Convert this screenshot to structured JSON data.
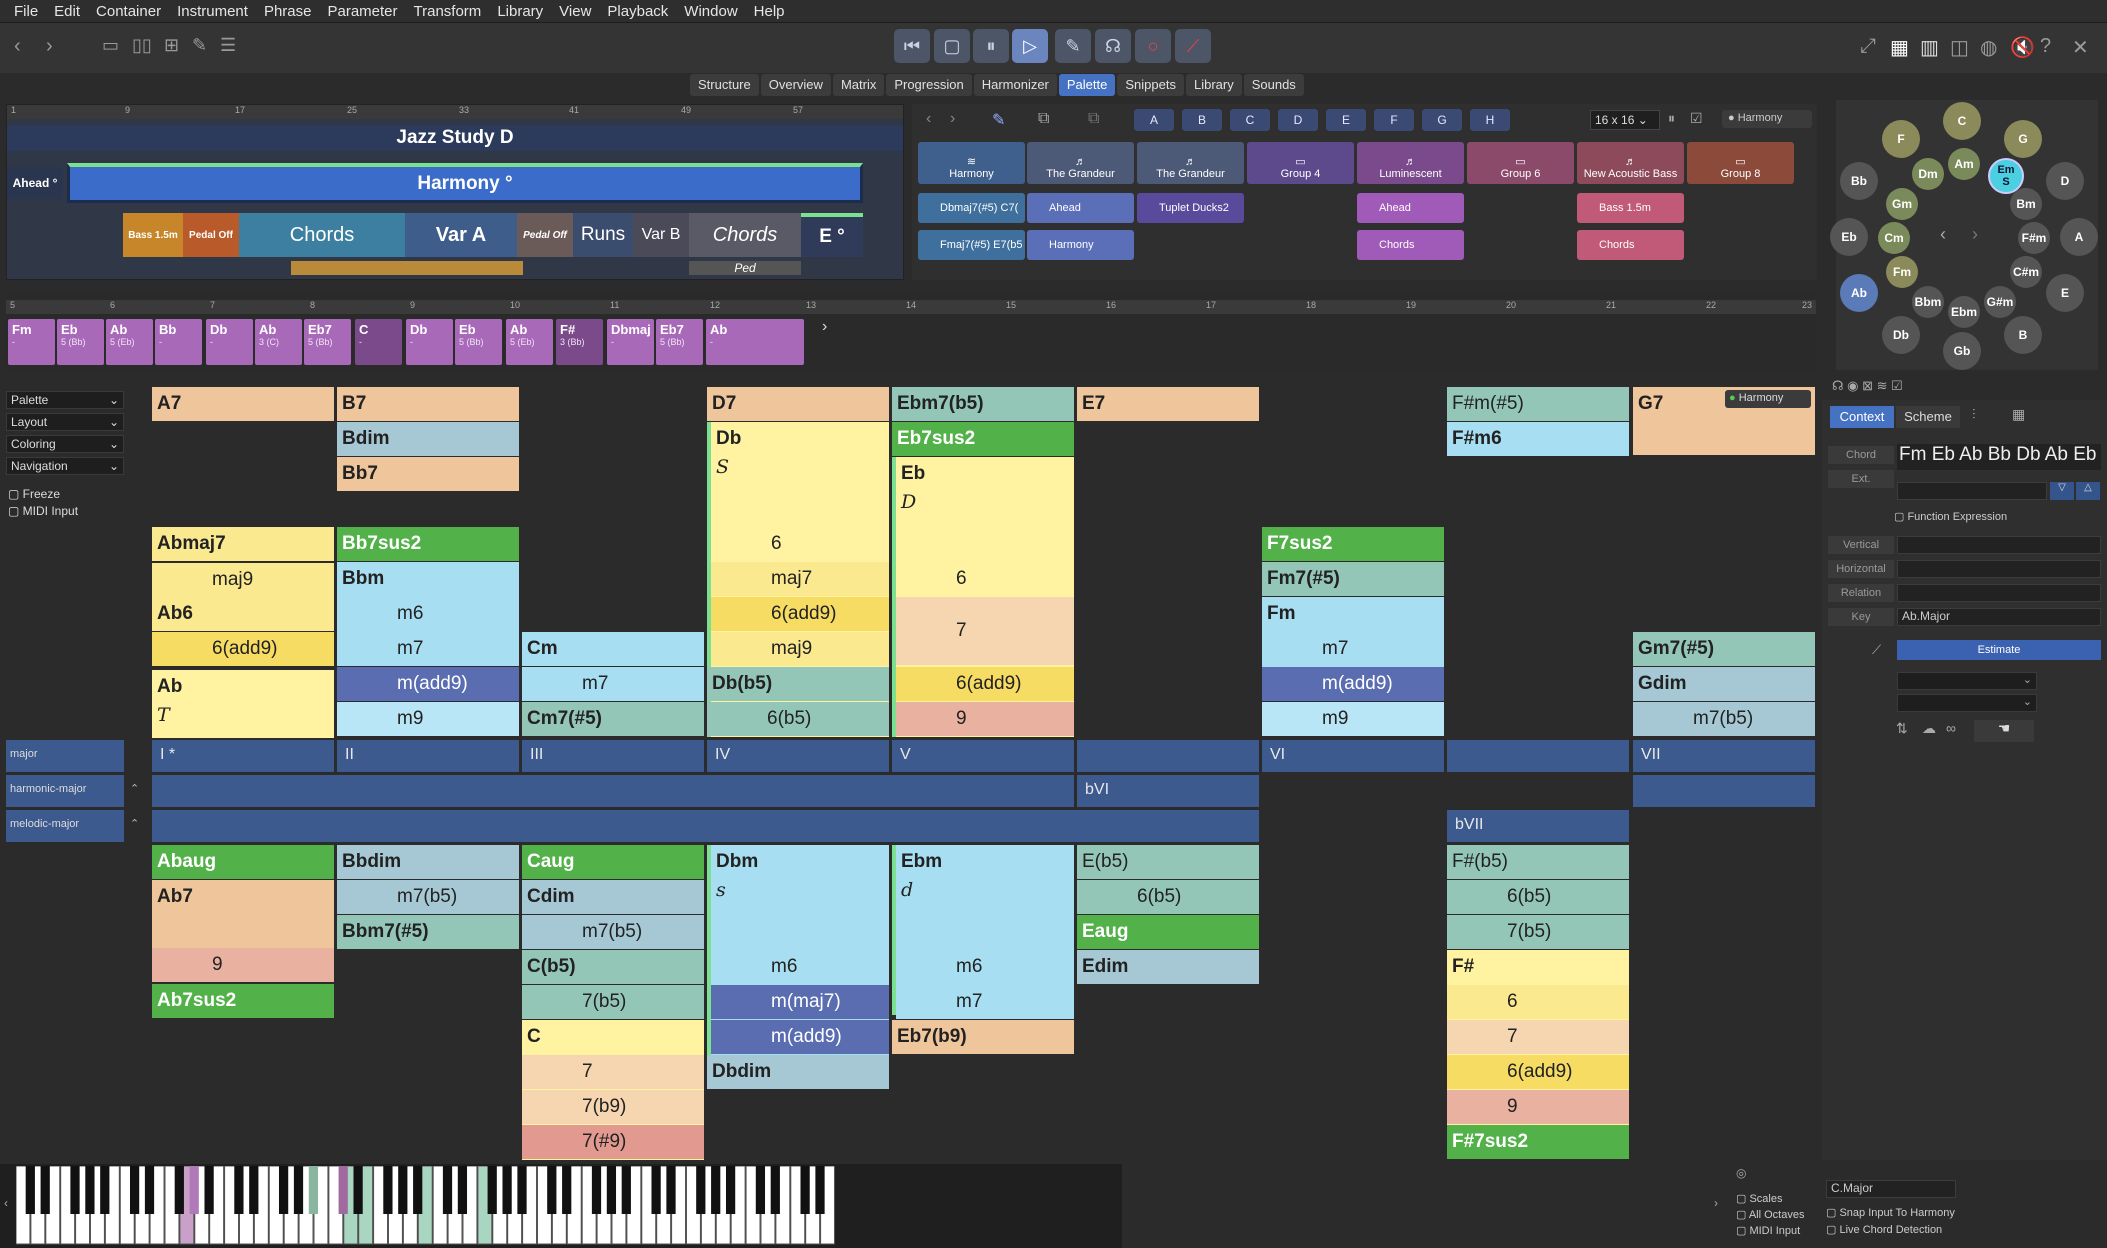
{
  "menu": [
    "File",
    "Edit",
    "Container",
    "Instrument",
    "Phrase",
    "Parameter",
    "Transform",
    "Library",
    "View",
    "Playback",
    "Window",
    "Help"
  ],
  "tabs": [
    "Structure",
    "Overview",
    "Matrix",
    "Progression",
    "Harmonizer",
    "Palette",
    "Snippets",
    "Library",
    "Sounds"
  ],
  "selected_tab": "Palette",
  "arrangement": {
    "ruler": [
      "1",
      "9",
      "17",
      "25",
      "33",
      "41",
      "49",
      "57"
    ],
    "title": "Jazz Study D",
    "ahead": "Ahead °",
    "harmony": "Harmony °",
    "blocks": {
      "bass": "Bass 1.5m",
      "pedal": "Pedal Off",
      "chords": "Chords",
      "var_a": "Var A",
      "pedal2": "Pedal Off",
      "runs": "Runs",
      "var_b": "Var B",
      "chords2": "Chords",
      "e": "E °",
      "ped": "Ped"
    }
  },
  "palette": {
    "letters": [
      "A",
      "B",
      "C",
      "D",
      "E",
      "F",
      "G",
      "H"
    ],
    "grid_size": "16 x 16",
    "harmony_label": "Harmony",
    "top": [
      "Harmony",
      "The Grandeur",
      "The Grandeur",
      "Group 4",
      "Luminescent",
      "Group 6",
      "New Acoustic Bass",
      "Group 8"
    ],
    "row2": [
      "Dbmaj7(#5) C7(",
      "Ahead",
      "Tuplet Ducks2",
      "",
      "Ahead",
      "",
      "Bass 1.5m",
      ""
    ],
    "row3": [
      "Fmaj7(#5) E7(b5",
      "Harmony",
      "",
      "",
      "Chords",
      "",
      "Chords",
      ""
    ]
  },
  "circle": {
    "outer": [
      "C",
      "G",
      "D",
      "A",
      "E",
      "B",
      "Gb",
      "Db",
      "Ab",
      "Eb",
      "Bb",
      "F"
    ],
    "inner": [
      "Am",
      "Em",
      "Bm",
      "F#m",
      "C#m",
      "G#m",
      "Ebm",
      "Bbm",
      "Fm",
      "Cm",
      "Gm",
      "Dm"
    ],
    "selected": "Em",
    "selected_sub": "S"
  },
  "chord_ruler": [
    "5",
    "6",
    "7",
    "8",
    "9",
    "10",
    "11",
    "12",
    "13",
    "14",
    "15",
    "16",
    "17",
    "18",
    "19",
    "20",
    "21",
    "22",
    "23"
  ],
  "chord_chips": [
    {
      "name": "Fm",
      "sub": "-"
    },
    {
      "name": "Eb",
      "sub": "5 (Bb)"
    },
    {
      "name": "Ab",
      "sub": "5 (Eb)"
    },
    {
      "name": "Bb",
      "sub": "-"
    },
    {
      "name": "Db",
      "sub": "-"
    },
    {
      "name": "Ab",
      "sub": "3 (C)"
    },
    {
      "name": "Eb7",
      "sub": "5 (Bb)"
    },
    {
      "name": "C",
      "sub": "-"
    },
    {
      "name": "Db",
      "sub": "-"
    },
    {
      "name": "Eb",
      "sub": "5 (Bb)"
    },
    {
      "name": "Ab",
      "sub": "5 (Eb)"
    },
    {
      "name": "F#",
      "sub": "3 (Bb)"
    },
    {
      "name": "Dbmaj",
      "sub": "-"
    },
    {
      "name": "Eb7",
      "sub": "5 (Bb)"
    },
    {
      "name": "Ab",
      "sub": "-"
    }
  ],
  "left_panel": {
    "dropdowns": [
      "Palette",
      "Layout",
      "Coloring",
      "Navigation"
    ],
    "checks": [
      "Freeze",
      "MIDI Input"
    ],
    "scales": [
      "major",
      "harmonic-major",
      "melodic-major"
    ]
  },
  "roman": [
    "I *",
    "II",
    "III",
    "IV",
    "V",
    "VI",
    "VII"
  ],
  "roman_row2": [
    "bVI"
  ],
  "roman_row3": [
    "bVII"
  ],
  "grid": {
    "c1": {
      "a7": "A7",
      "abmaj7": "Abmaj7",
      "maj9": "maj9",
      "ab6": "Ab6",
      "add9": "6(add9)",
      "ab": "Ab",
      "T": "T",
      "abaug": "Abaug",
      "ab7": "Ab7",
      "n9": "9",
      "ab7sus2": "Ab7sus2"
    },
    "c2": {
      "b7": "B7",
      "bdim": "Bdim",
      "bb7": "Bb7",
      "bb7sus2": "Bb7sus2",
      "bbm": "Bbm",
      "m6": "m6",
      "m7": "m7",
      "madd9": "m(add9)",
      "m9": "m9",
      "bbdim": "Bbdim",
      "m7b5": "m7(b5)",
      "bbm7s5": "Bbm7(#5)"
    },
    "c3": {
      "cm": "Cm",
      "m7": "m7",
      "cm7s5": "Cm7(#5)",
      "caug": "Caug",
      "cdim": "Cdim",
      "m7b5": "m7(b5)",
      "cb5": "C(b5)",
      "7b5": "7(b5)",
      "c": "C",
      "7": "7",
      "7b9": "7(b9)",
      "7s9": "7(#9)"
    },
    "c4": {
      "d7": "D7",
      "db": "Db",
      "S": "S",
      "6": "6",
      "maj7": "maj7",
      "add9": "6(add9)",
      "maj9": "maj9",
      "dbb5": "Db(b5)",
      "6b5": "6(b5)",
      "dbm": "Dbm",
      "s": "s",
      "m6": "m6",
      "mmaj7": "m(maj7)",
      "madd9": "m(add9)",
      "dbdim": "Dbdim"
    },
    "c5": {
      "ebm7b5": "Ebm7(b5)",
      "eb7sus2": "Eb7sus2",
      "eb": "Eb",
      "D": "D",
      "6": "6",
      "7": "7",
      "add9": "6(add9)",
      "9": "9",
      "ebm": "Ebm",
      "d": "d",
      "m6": "m6",
      "m7": "m7",
      "eb7b9": "Eb7(b9)"
    },
    "c6": {
      "e7": "E7",
      "eb5": "E(b5)",
      "6b5": "6(b5)",
      "eaug": "Eaug",
      "edim": "Edim"
    },
    "c7": {
      "f7sus2": "F7sus2",
      "fm7s5": "Fm7(#5)",
      "fm": "Fm",
      "m7": "m7",
      "madd9": "m(add9)",
      "m9": "m9"
    },
    "c8": {
      "fsm5": "F#m(#5)",
      "fsm6": "F#m6",
      "fsb5": "F#(b5)",
      "6b5": "6(b5)",
      "7b5": "7(b5)",
      "fs": "F#",
      "6": "6",
      "7": "7",
      "add9": "6(add9)",
      "9": "9",
      "fs7sus2": "F#7sus2"
    },
    "c9": {
      "g7": "G7",
      "harmony": "Harmony",
      "gm7s5": "Gm7(#5)",
      "gdim": "Gdim",
      "m7b5": "m7(b5)"
    }
  },
  "right_panel": {
    "tabs": [
      "Context",
      "Scheme"
    ],
    "chord_label": "Chord",
    "ext_label": "Ext.",
    "chord_value": "Fm Eb Ab Bb Db Ab Eb",
    "function_expression": "Function Expression",
    "labels": [
      "Vertical",
      "Horizontal",
      "Relation",
      "Key"
    ],
    "key_value": "Ab.Major",
    "estimate": "Estimate"
  },
  "bottom": {
    "checks": [
      "Scales",
      "All Octaves",
      "MIDI Input"
    ],
    "scale_value": "C.Major",
    "snap": "Snap Input To Harmony",
    "live": "Live Chord Detection"
  }
}
